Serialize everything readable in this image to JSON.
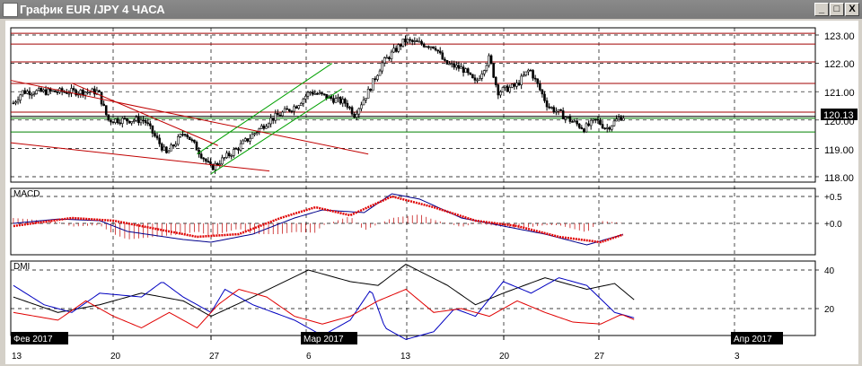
{
  "window": {
    "title": "График EUR /JPY  4 ЧАСА",
    "minimize": "_",
    "maximize": "□",
    "close": "X"
  },
  "price_axis": {
    "labels": [
      "123.00",
      "122.00",
      "121.00",
      "120.00",
      "119.00",
      "118.00"
    ],
    "current": "120.13"
  },
  "macd": {
    "title": "MACD",
    "labels": [
      "+0.5",
      "+0.0"
    ]
  },
  "dmi": {
    "title": "DMI",
    "labels": [
      "40",
      "20"
    ]
  },
  "time_axis": {
    "days": [
      "13",
      "20",
      "27",
      "6",
      "13",
      "20",
      "27",
      "3"
    ],
    "months": [
      "Фев 2017",
      "Мар 2017",
      "Апр 2017"
    ]
  },
  "chart_data": {
    "type": "candlestick",
    "symbol": "EUR/JPY",
    "timeframe": "4H",
    "ylim": [
      117.8,
      123.3
    ],
    "price_path": [
      [
        -0.2,
        120.6
      ],
      [
        0.45,
        121.0
      ],
      [
        5.9,
        121.0
      ],
      [
        6.6,
        120.0
      ],
      [
        9.2,
        120.0
      ],
      [
        10.8,
        118.8
      ],
      [
        12.1,
        119.6
      ],
      [
        14,
        118.3
      ],
      [
        15.9,
        119.0
      ],
      [
        18.2,
        120.0
      ],
      [
        20.1,
        120.5
      ],
      [
        21.1,
        121.0
      ],
      [
        23.7,
        120.6
      ],
      [
        24.3,
        120.2
      ],
      [
        25.3,
        121.0
      ],
      [
        26.3,
        122.0
      ],
      [
        27.9,
        122.8
      ],
      [
        30.1,
        122.6
      ],
      [
        30.8,
        122.0
      ],
      [
        32.1,
        121.8
      ],
      [
        33,
        121.3
      ],
      [
        34,
        122.2
      ],
      [
        34.6,
        121.0
      ],
      [
        35.9,
        121.2
      ],
      [
        36.9,
        121.8
      ],
      [
        38.2,
        120.5
      ],
      [
        39.8,
        120.0
      ],
      [
        40.8,
        119.7
      ],
      [
        41.7,
        120.0
      ],
      [
        42.4,
        119.7
      ],
      [
        43.4,
        120.1
      ],
      [
        43.7,
        120.13
      ]
    ],
    "horizontal_levels": [
      {
        "price": 123.06,
        "color": "#a00000"
      },
      {
        "price": 122.68,
        "color": "#a00000"
      },
      {
        "price": 122.05,
        "color": "#a00000"
      },
      {
        "price": 121.29,
        "color": "#a00000"
      },
      {
        "price": 120.28,
        "color": "#a00000"
      },
      {
        "price": 120.13,
        "color": "#000000"
      },
      {
        "price": 120.06,
        "color": "#008000"
      },
      {
        "price": 119.58,
        "color": "#008000"
      }
    ],
    "trendlines": [
      {
        "from": [
          -0.4,
          121.4
        ],
        "to": [
          25.3,
          118.8
        ],
        "color": "#c00000"
      },
      {
        "from": [
          4,
          121.3
        ],
        "to": [
          14.5,
          119.1
        ],
        "color": "#c00000"
      },
      {
        "from": [
          -0.4,
          119.2
        ],
        "to": [
          18.2,
          118.2
        ],
        "color": "#c00000"
      },
      {
        "from": [
          13,
          118.8
        ],
        "to": [
          22.7,
          122.0
        ],
        "color": "#00a000"
      },
      {
        "from": [
          14,
          118.1
        ],
        "to": [
          23.4,
          121.1
        ],
        "color": "#00a000"
      }
    ],
    "macd_line": [
      [
        -0.2,
        0.0
      ],
      [
        3,
        0.08
      ],
      [
        6,
        0.05
      ],
      [
        8,
        -0.15
      ],
      [
        12,
        -0.3
      ],
      [
        14,
        -0.35
      ],
      [
        17,
        -0.2
      ],
      [
        20,
        0.1
      ],
      [
        22,
        0.25
      ],
      [
        25,
        0.2
      ],
      [
        27,
        0.55
      ],
      [
        29,
        0.45
      ],
      [
        32,
        0.1
      ],
      [
        35,
        -0.05
      ],
      [
        38,
        -0.2
      ],
      [
        41,
        -0.4
      ],
      [
        43.7,
        -0.2
      ]
    ],
    "macd_signal": [
      [
        -0.2,
        -0.05
      ],
      [
        4,
        0.1
      ],
      [
        7,
        0.05
      ],
      [
        10,
        -0.1
      ],
      [
        13,
        -0.25
      ],
      [
        16,
        -0.2
      ],
      [
        19,
        0.1
      ],
      [
        21.5,
        0.3
      ],
      [
        24,
        0.15
      ],
      [
        27,
        0.5
      ],
      [
        30,
        0.3
      ],
      [
        33,
        0.05
      ],
      [
        36,
        -0.05
      ],
      [
        39,
        -0.25
      ],
      [
        42,
        -0.35
      ],
      [
        43.7,
        -0.2
      ]
    ],
    "adx": [
      [
        -0.2,
        26
      ],
      [
        3,
        18
      ],
      [
        6,
        22
      ],
      [
        9,
        28
      ],
      [
        12,
        24
      ],
      [
        14,
        16
      ],
      [
        17,
        26
      ],
      [
        21,
        40
      ],
      [
        24,
        34
      ],
      [
        26,
        32
      ],
      [
        28,
        43
      ],
      [
        31,
        32
      ],
      [
        33,
        22
      ],
      [
        35,
        28
      ],
      [
        38,
        36
      ],
      [
        41,
        30
      ],
      [
        43,
        33
      ],
      [
        44.5,
        24
      ]
    ],
    "plus_di": [
      [
        -0.2,
        32
      ],
      [
        2,
        22
      ],
      [
        4,
        18
      ],
      [
        6,
        28
      ],
      [
        9,
        26
      ],
      [
        10.5,
        34
      ],
      [
        12,
        26
      ],
      [
        14,
        18
      ],
      [
        15,
        30
      ],
      [
        17,
        22
      ],
      [
        20,
        14
      ],
      [
        22,
        6
      ],
      [
        24,
        14
      ],
      [
        25.5,
        30
      ],
      [
        26.5,
        10
      ],
      [
        28,
        4
      ],
      [
        30,
        8
      ],
      [
        31.5,
        20
      ],
      [
        33,
        16
      ],
      [
        35,
        34
      ],
      [
        37,
        28
      ],
      [
        39,
        36
      ],
      [
        41,
        32
      ],
      [
        43,
        18
      ],
      [
        44.5,
        15
      ]
    ],
    "minus_di": [
      [
        -0.2,
        18
      ],
      [
        3,
        14
      ],
      [
        5,
        24
      ],
      [
        7,
        16
      ],
      [
        9,
        10
      ],
      [
        11,
        18
      ],
      [
        13,
        10
      ],
      [
        14.5,
        22
      ],
      [
        16,
        30
      ],
      [
        18,
        26
      ],
      [
        20,
        16
      ],
      [
        22,
        12
      ],
      [
        24,
        16
      ],
      [
        26,
        24
      ],
      [
        28,
        30
      ],
      [
        30,
        18
      ],
      [
        32,
        20
      ],
      [
        34,
        16
      ],
      [
        36,
        24
      ],
      [
        38,
        18
      ],
      [
        40,
        13
      ],
      [
        42,
        12
      ],
      [
        43.5,
        17
      ],
      [
        44.5,
        14
      ]
    ]
  }
}
